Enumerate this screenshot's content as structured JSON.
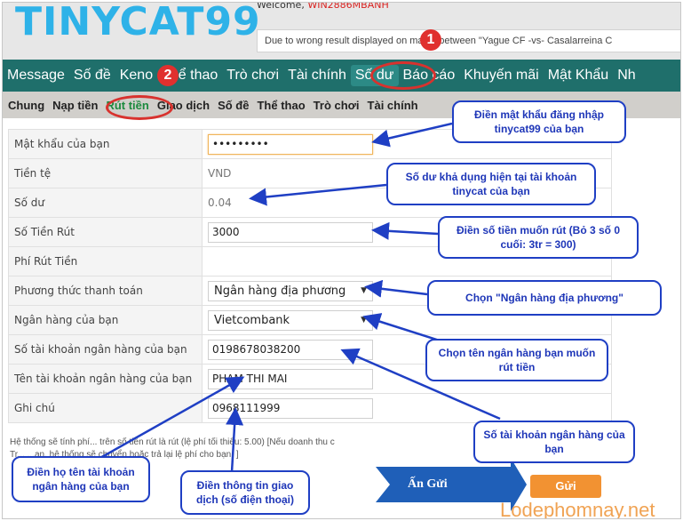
{
  "header": {
    "logo": "TINYCAT99",
    "welcome_prefix": "Welcome,",
    "username": "WIN2886MBANH",
    "marquee": "Due to wrong result displayed on match between \"Yague CF -vs- Casalarreina C"
  },
  "main_nav": [
    {
      "label": "Message"
    },
    {
      "label": "Số đề"
    },
    {
      "label": "Keno"
    },
    {
      "label": "Thể thao"
    },
    {
      "label": "Trò chơi"
    },
    {
      "label": "Tài chính"
    },
    {
      "label": "Số dư"
    },
    {
      "label": "Báo cáo"
    },
    {
      "label": "Khuyến mãi"
    },
    {
      "label": "Mật Khẩu"
    },
    {
      "label": "Nh"
    }
  ],
  "sub_nav": [
    {
      "label": "Chung"
    },
    {
      "label": "Nạp tiền"
    },
    {
      "label": "Rút tiền"
    },
    {
      "label": "Giao dịch"
    },
    {
      "label": "Số đề"
    },
    {
      "label": "Thể thao"
    },
    {
      "label": "Trò chơi"
    },
    {
      "label": "Tài chính"
    }
  ],
  "form": {
    "password_label": "Mật khẩu của bạn",
    "password_value": "•••••••••",
    "currency_label": "Tiền tệ",
    "currency_value": "VND",
    "balance_label": "Số dư",
    "balance_value": "0.04",
    "amount_label": "Số Tiền Rút",
    "amount_value": "3000",
    "fee_label": "Phí Rút Tiền",
    "method_label": "Phương thức thanh toán",
    "method_value": "Ngân hàng địa phương",
    "bank_label": "Ngân hàng của bạn",
    "bank_value": "Vietcombank",
    "account_no_label": "Số tài khoản ngân hàng của bạn",
    "account_no_value": "0198678038200",
    "account_name_label": "Tên tài khoản ngân hàng của bạn",
    "account_name_value": "PHAM THI MAI",
    "note_label": "Ghi chú",
    "note_value": "0968111999"
  },
  "footer_note": {
    "line1": "Hệ thống sẽ tính phí... trên số tiền rút là rút (lệ phí tối thiểu: 5.00) [Nếu doanh thu c",
    "line2": "Tr... ...an, hệ thống sẽ chuyển hoặc trả lại lệ phí cho bạn. ]"
  },
  "buttons": {
    "submit": "Gửi",
    "press_submit": "Ấn Gửi"
  },
  "annotations": {
    "badge1": "1",
    "badge2": "2",
    "c_password": "Điền mật khẩu đăng nhập tinycat99 của bạn",
    "c_balance": "Số dư khả dụng hiện tại tài khoản tinycat của bạn",
    "c_amount": "Điền số tiền muốn rút (Bỏ 3 số 0 cuối: 3tr = 300)",
    "c_method": "Chọn \"Ngân hàng địa phương\"",
    "c_bank": "Chọn tên ngân hàng bạn muốn rút tiền",
    "c_account_no": "Số tài khoản ngân hàng của bạn",
    "c_account_name": "Điền họ tên tài khoản ngân hàng của bạn",
    "c_note": "Điền thông tin giao dịch (số điện thoại)"
  },
  "watermark": "Lodephomnay.net",
  "colors": {
    "logo": "#2eb2e8",
    "main_nav_bg": "#1f6f6b",
    "sub_nav_bg": "#d1cfcb",
    "callout_border": "#1f3fc4",
    "marker_red": "#d8322e",
    "submit_bg": "#f29232"
  }
}
